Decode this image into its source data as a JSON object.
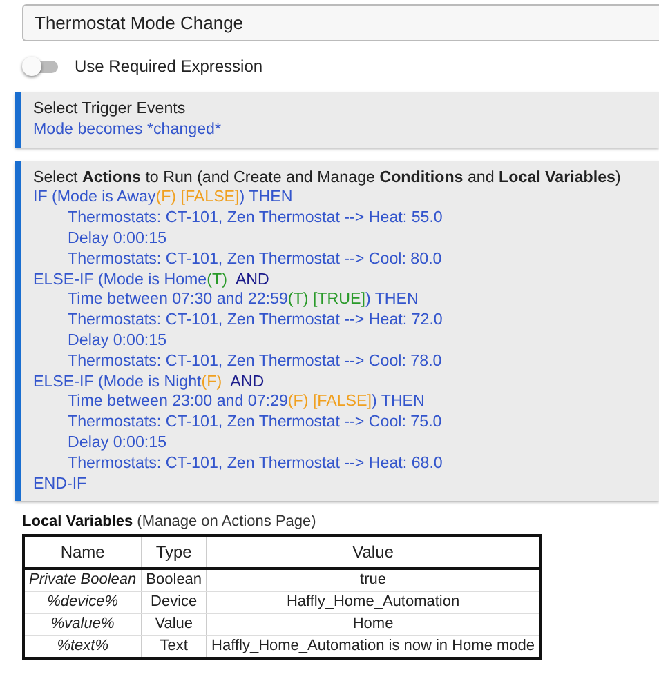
{
  "name_field": {
    "value": "Thermostat Mode Change"
  },
  "required_expression": {
    "label": "Use Required Expression",
    "on": false
  },
  "trigger_section": {
    "title": "Select Trigger Events",
    "events": [
      "Mode becomes *changed*"
    ]
  },
  "actions_section": {
    "title": "Select **Actions** to Run (and Create and Manage **Conditions** and **Local Variables**)",
    "lines": [
      {
        "parts": [
          {
            "kind": "plain",
            "text": "IF (Mode is Away"
          },
          {
            "kind": "false",
            "text": "(F) [FALSE]"
          },
          {
            "kind": "plain",
            "text": ") THEN"
          }
        ],
        "children": [
          {
            "parts": [
              {
                "kind": "plain",
                "text": "Thermostats: CT-101, Zen Thermostat --> Heat: 55.0"
              }
            ]
          },
          {
            "parts": [
              {
                "kind": "plain",
                "text": "Delay 0:00:15"
              }
            ]
          },
          {
            "parts": [
              {
                "kind": "plain",
                "text": "Thermostats: CT-101, Zen Thermostat --> Cool: 80.0"
              }
            ]
          }
        ]
      },
      {
        "parts": [
          {
            "kind": "plain",
            "text": "ELSE-IF (Mode is Home"
          },
          {
            "kind": "true",
            "text": "(T)"
          },
          {
            "kind": "operator",
            "text": "AND"
          }
        ],
        "children": [
          {
            "parts": [
              {
                "kind": "plain",
                "text": "Time between 07:30 and 22:59"
              },
              {
                "kind": "true",
                "text": "(T) [TRUE]"
              },
              {
                "kind": "plain",
                "text": ") THEN"
              }
            ]
          },
          {
            "parts": [
              {
                "kind": "plain",
                "text": "Thermostats: CT-101, Zen Thermostat --> Heat: 72.0"
              }
            ]
          },
          {
            "parts": [
              {
                "kind": "plain",
                "text": "Delay 0:00:15"
              }
            ]
          },
          {
            "parts": [
              {
                "kind": "plain",
                "text": "Thermostats: CT-101, Zen Thermostat --> Cool: 78.0"
              }
            ]
          }
        ]
      },
      {
        "parts": [
          {
            "kind": "plain",
            "text": "ELSE-IF (Mode is Night"
          },
          {
            "kind": "false",
            "text": "(F)"
          },
          {
            "kind": "operator",
            "text": "AND"
          }
        ],
        "children": [
          {
            "parts": [
              {
                "kind": "plain",
                "text": "Time between 23:00 and 07:29"
              },
              {
                "kind": "false",
                "text": "(F) [FALSE]"
              },
              {
                "kind": "plain",
                "text": ") THEN"
              }
            ]
          },
          {
            "parts": [
              {
                "kind": "plain",
                "text": "Thermostats: CT-101, Zen Thermostat --> Cool: 75.0"
              }
            ]
          },
          {
            "parts": [
              {
                "kind": "plain",
                "text": "Delay 0:00:15"
              }
            ]
          },
          {
            "parts": [
              {
                "kind": "plain",
                "text": "Thermostats: CT-101, Zen Thermostat --> Heat: 68.0"
              }
            ]
          }
        ]
      },
      {
        "parts": [
          {
            "kind": "plain",
            "text": "END-IF"
          }
        ]
      }
    ]
  },
  "local_variables": {
    "title": "**Local Variables** (Manage on Actions Page)",
    "columns": [
      "Name",
      "Type",
      "Value"
    ],
    "rows": [
      [
        "Private Boolean",
        "Boolean",
        "true"
      ],
      [
        "%device%",
        "Device",
        "Haffly_Home_Automation"
      ],
      [
        "%value%",
        "Value",
        "Home"
      ],
      [
        "%text%",
        "Text",
        "Haffly_Home_Automation is now in Home mode"
      ]
    ]
  }
}
